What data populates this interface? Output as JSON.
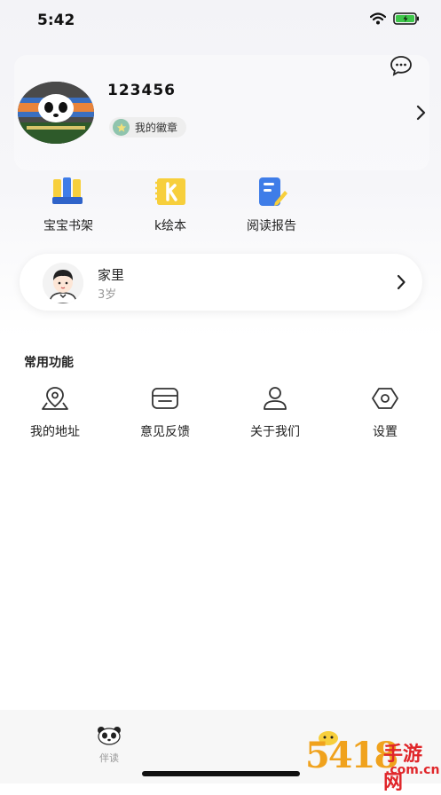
{
  "status_bar": {
    "time": "5:42"
  },
  "profile": {
    "username": "123456",
    "badge_label": "我的徽章"
  },
  "quick_links": [
    {
      "label": "宝宝书架",
      "icon": "bookshelf-icon"
    },
    {
      "label": "k绘本",
      "icon": "k-picturebook-icon"
    },
    {
      "label": "阅读报告",
      "icon": "reading-report-icon"
    }
  ],
  "child": {
    "name": "家里",
    "age": "3岁"
  },
  "common_functions": {
    "title": "常用功能",
    "items": [
      {
        "label": "我的地址",
        "icon": "location-icon"
      },
      {
        "label": "意见反馈",
        "icon": "feedback-icon"
      },
      {
        "label": "关于我们",
        "icon": "user-icon"
      },
      {
        "label": "设置",
        "icon": "settings-icon"
      }
    ]
  },
  "tab_bar": {
    "tabs": [
      {
        "label": "伴读",
        "icon": "panda-icon"
      }
    ]
  },
  "watermark": {
    "digits": "5418",
    "text": "手游网",
    "domain": ".com.cn"
  },
  "colors": {
    "accent_yellow": "#f7cf3c",
    "accent_blue": "#3f7de8",
    "badge_green": "#8fc4ad",
    "watermark_orange": "#f0a21d",
    "watermark_red": "#e0262a"
  }
}
